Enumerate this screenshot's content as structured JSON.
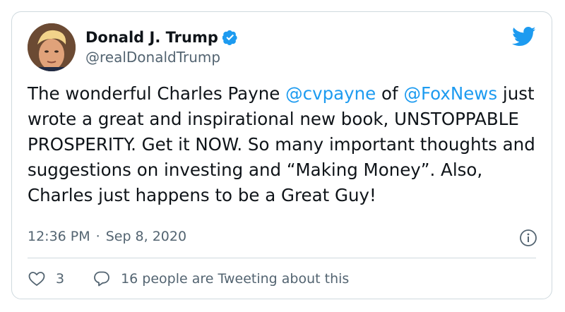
{
  "author": {
    "display_name": "Donald J. Trump",
    "handle": "@realDonaldTrump",
    "verified": true,
    "avatar_icon": "profile-photo"
  },
  "tweet": {
    "segments": [
      {
        "text": "The wonderful Charles Payne ",
        "kind": "text"
      },
      {
        "text": "@cvpayne",
        "kind": "mention"
      },
      {
        "text": " of ",
        "kind": "text"
      },
      {
        "text": "@FoxNews",
        "kind": "mention"
      },
      {
        "text": " just wrote a great and inspirational new book, UNSTOPPABLE PROSPERITY. Get it NOW. So many important thoughts and suggestions on investing and “Making Money”. Also, Charles just happens to be a Great Guy!",
        "kind": "text"
      }
    ]
  },
  "meta": {
    "time": "12:36 PM",
    "separator": "·",
    "date": "Sep 8, 2020",
    "info_icon": "info-icon"
  },
  "actions": {
    "like_count": "3",
    "reply_label": "16 people are Tweeting about this",
    "like_icon": "heart-icon",
    "reply_icon": "speech-bubble-icon"
  },
  "brand": {
    "logo": "twitter-bird-icon",
    "accent": "#1d9bf0",
    "text_color": "#0f1419",
    "muted_color": "#536471",
    "border_color": "#cfd9de"
  }
}
